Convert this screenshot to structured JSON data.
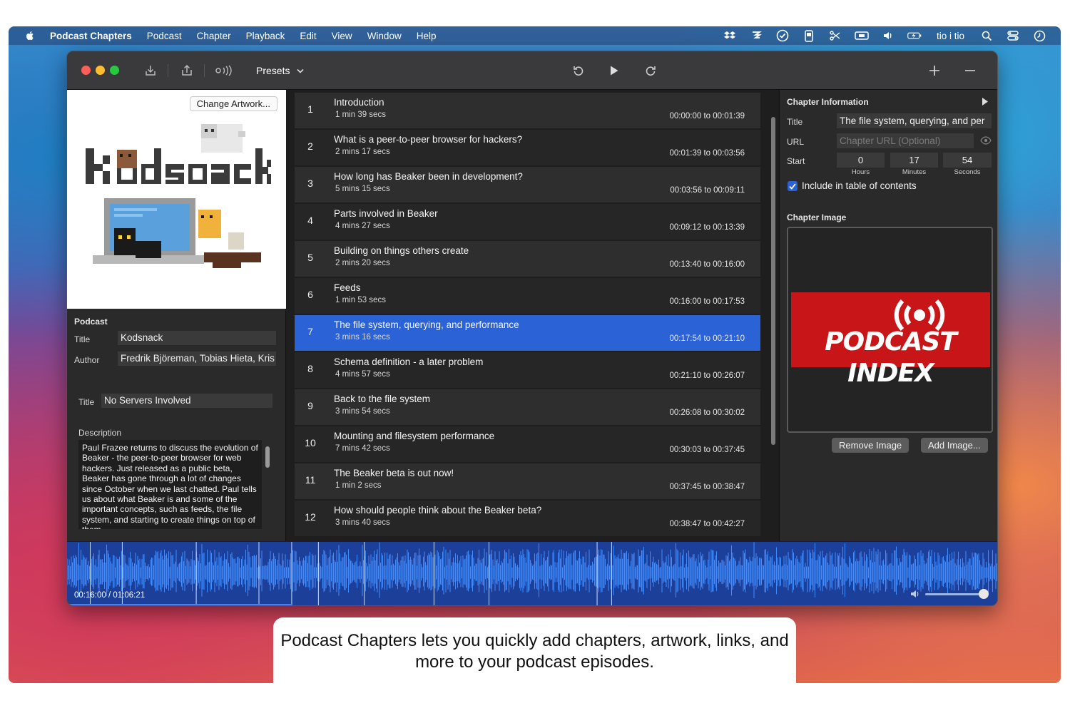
{
  "menubar": {
    "app_name": "Podcast Chapters",
    "items": [
      "Podcast",
      "Chapter",
      "Playback",
      "Edit",
      "View",
      "Window",
      "Help"
    ],
    "user": "tio i tio"
  },
  "toolbar": {
    "presets_label": "Presets"
  },
  "artwork": {
    "change_label": "Change Artwork...",
    "logo_text": "kodsnack"
  },
  "podcast": {
    "section_label": "Podcast",
    "title_label": "Title",
    "title_value": "Kodsnack",
    "author_label": "Author",
    "author_value": "Fredrik Björeman, Tobias Hieta, Kris"
  },
  "episode": {
    "title_label": "Title",
    "title_value": "No Servers Involved",
    "description_label": "Description",
    "description_value": "Paul Frazee returns to discuss the evolution of Beaker - the peer-to-peer browser for web hackers. Just released as a public beta, Beaker has gone through a lot of changes since October when we last chatted. Paul tells us about what Beaker is and some of the important concepts, such as feeds, the file system, and starting to create things on top of them."
  },
  "chapters": [
    {
      "num": "1",
      "title": "Introduction",
      "duration": "1 min 39 secs",
      "range": "00:00:00 to 00:01:39"
    },
    {
      "num": "2",
      "title": "What is a peer-to-peer browser for hackers?",
      "duration": "2 mins 17 secs",
      "range": "00:01:39 to 00:03:56"
    },
    {
      "num": "3",
      "title": "How long has Beaker been in development?",
      "duration": "5 mins 15 secs",
      "range": "00:03:56 to 00:09:11"
    },
    {
      "num": "4",
      "title": "Parts involved in Beaker",
      "duration": "4 mins 27 secs",
      "range": "00:09:12 to 00:13:39"
    },
    {
      "num": "5",
      "title": "Building on things others create",
      "duration": "2 mins 20 secs",
      "range": "00:13:40 to 00:16:00"
    },
    {
      "num": "6",
      "title": "Feeds",
      "duration": "1 min 53 secs",
      "range": "00:16:00 to 00:17:53"
    },
    {
      "num": "7",
      "title": "The file system, querying, and performance",
      "duration": "3 mins 16 secs",
      "range": "00:17:54 to 00:21:10"
    },
    {
      "num": "8",
      "title": "Schema definition - a later problem",
      "duration": "4 mins 57 secs",
      "range": "00:21:10 to 00:26:07"
    },
    {
      "num": "9",
      "title": "Back to the file system",
      "duration": "3 mins 54 secs",
      "range": "00:26:08 to 00:30:02"
    },
    {
      "num": "10",
      "title": "Mounting and filesystem performance",
      "duration": "7 mins 42 secs",
      "range": "00:30:03 to 00:37:45"
    },
    {
      "num": "11",
      "title": "The Beaker beta is out now!",
      "duration": "1 min 2 secs",
      "range": "00:37:45 to 00:38:47"
    },
    {
      "num": "12",
      "title": "How should people think about the Beaker beta?",
      "duration": "3 mins 40 secs",
      "range": "00:38:47 to 00:42:27"
    }
  ],
  "selected_chapter": 7,
  "chapter_info": {
    "section_label": "Chapter Information",
    "title_label": "Title",
    "title_value": "The file system, querying, and per",
    "url_label": "URL",
    "url_placeholder": "Chapter URL (Optional)",
    "start_label": "Start",
    "hours": "0",
    "minutes": "17",
    "seconds": "54",
    "hours_caption": "Hours",
    "minutes_caption": "Minutes",
    "seconds_caption": "Seconds",
    "toc_label": "Include in table of contents",
    "toc_checked": true,
    "image_label": "Chapter Image",
    "image_logo_text": "PODCAST INDEX",
    "remove_label": "Remove Image",
    "add_label": "Add Image..."
  },
  "playback": {
    "time_readout": "00:16:00 / 01:06:21",
    "position_fraction": 0.241,
    "volume_fraction": 1.0
  },
  "caption": {
    "line1": "Podcast Chapters lets you quickly add chapters, artwork, links, and",
    "line2": "more to your podcast episodes."
  },
  "colors": {
    "accent": "#2b63d7",
    "close": "#ff5f57",
    "minimize": "#febc2e",
    "zoom": "#28c840",
    "podcast_index_red": "#c81518"
  }
}
